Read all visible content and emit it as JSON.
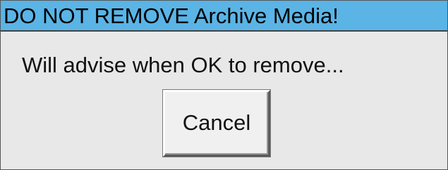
{
  "dialog": {
    "title": "DO NOT REMOVE Archive Media!",
    "message": "Will advise when OK to remove...",
    "cancel_label": "Cancel"
  },
  "colors": {
    "title_bar": "#5ab4e6",
    "dialog_background": "#e8e8e8",
    "button_face": "#f0f0f0"
  }
}
